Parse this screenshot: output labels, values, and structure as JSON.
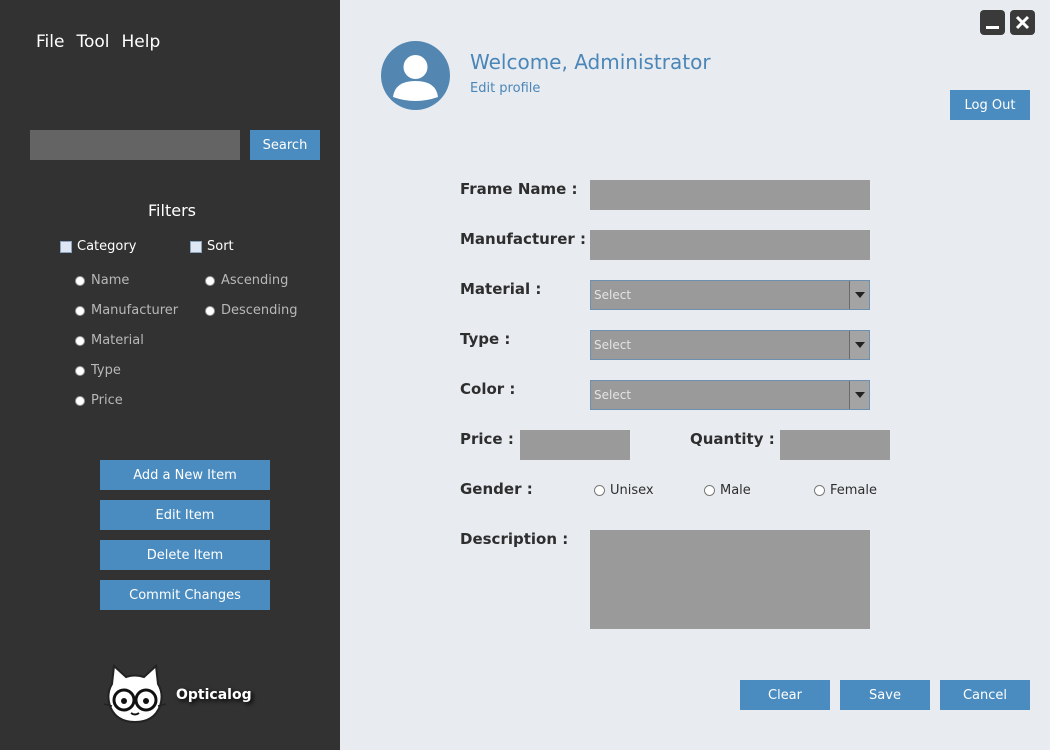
{
  "menu": {
    "file": "File",
    "tool": "Tool",
    "help": "Help"
  },
  "search": {
    "value": "",
    "button_label": "Search"
  },
  "filters": {
    "title": "Filters",
    "category": {
      "label": "Category",
      "options": [
        "Name",
        "Manufacturer",
        "Material",
        "Type",
        "Price"
      ]
    },
    "sort": {
      "label": "Sort",
      "options": [
        "Ascending",
        "Descending"
      ]
    }
  },
  "sidebar_actions": {
    "add": "Add a New Item",
    "edit": "Edit Item",
    "delete": "Delete Item",
    "commit": "Commit Changes"
  },
  "brand": {
    "name": "Opticalog"
  },
  "header": {
    "welcome": "Welcome, Administrator",
    "edit_profile": "Edit profile",
    "logout": "Log Out"
  },
  "form": {
    "frame_name": {
      "label": "Frame Name :",
      "value": ""
    },
    "manufacturer": {
      "label": "Manufacturer :",
      "value": ""
    },
    "material": {
      "label": "Material :",
      "value": "Select"
    },
    "type": {
      "label": "Type :",
      "value": "Select"
    },
    "color": {
      "label": "Color :",
      "value": "Select"
    },
    "price": {
      "label": "Price :",
      "value": ""
    },
    "quantity": {
      "label": "Quantity :",
      "value": ""
    },
    "gender": {
      "label": "Gender :",
      "options": [
        "Unisex",
        "Male",
        "Female"
      ]
    },
    "description": {
      "label": "Description :",
      "value": ""
    }
  },
  "actions": {
    "clear": "Clear",
    "save": "Save",
    "cancel": "Cancel"
  },
  "colors": {
    "sidebar": "#333233",
    "accent": "#4a8cc0",
    "main_bg": "#e8ecf0",
    "field": "#9a9a9a"
  }
}
